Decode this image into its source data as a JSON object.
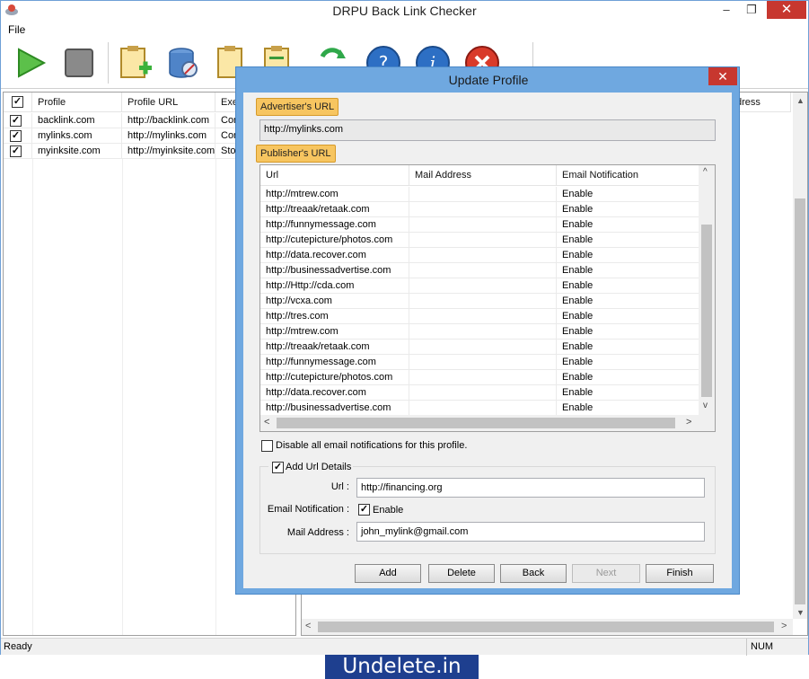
{
  "app": {
    "title": "DRPU Back Link Checker",
    "window_buttons": {
      "minimize": "–",
      "restore": "❐",
      "close": "✕"
    },
    "menu": [
      "File"
    ]
  },
  "toolbar": {
    "buttons": [
      {
        "name": "start",
        "icon": "play-icon"
      },
      {
        "name": "stop",
        "icon": "stop-icon"
      },
      {
        "name": "add-profile",
        "icon": "clipboard-add-icon"
      },
      {
        "name": "database",
        "icon": "database-icon"
      },
      {
        "name": "edit-profile",
        "icon": "clipboard-edit-icon"
      },
      {
        "name": "report",
        "icon": "clipboard-list-icon"
      },
      {
        "name": "refresh",
        "icon": "refresh-icon"
      },
      {
        "name": "help",
        "icon": "help-icon"
      },
      {
        "name": "about",
        "icon": "info-icon"
      },
      {
        "name": "exit",
        "icon": "exit-icon"
      }
    ]
  },
  "main_grid": {
    "headers": [
      "Profile",
      "Profile URL",
      "Exe"
    ],
    "rows": [
      {
        "checked": true,
        "profile": "backlink.com",
        "url": "http://backlink.com",
        "exe": "Cor"
      },
      {
        "checked": true,
        "profile": "mylinks.com",
        "url": "http://mylinks.com",
        "exe": "Cor"
      },
      {
        "checked": true,
        "profile": "myinksite.com",
        "url": "http://myinksite.com",
        "exe": "Sto"
      }
    ]
  },
  "right_grid": {
    "header_fragment": "dress"
  },
  "statusbar": {
    "left": "Ready",
    "right": "NUM"
  },
  "brand": "Undelete.in",
  "dialog": {
    "title": "Update Profile",
    "close": "✕",
    "advertiser_label": "Advertiser's URL",
    "advertiser_url": "http://mylinks.com",
    "publisher_label": "Publisher's URL",
    "publisher_headers": [
      "Url",
      "Mail Address",
      "Email Notification"
    ],
    "publisher_rows": [
      {
        "url": "http://mtrew.com",
        "mail": "",
        "notify": "Enable"
      },
      {
        "url": "http://treaak/retaak.com",
        "mail": "",
        "notify": "Enable"
      },
      {
        "url": "http://funnymessage.com",
        "mail": "",
        "notify": "Enable"
      },
      {
        "url": "http://cutepicture/photos.com",
        "mail": "",
        "notify": "Enable"
      },
      {
        "url": "http://data.recover.com",
        "mail": "",
        "notify": "Enable"
      },
      {
        "url": "http://businessadvertise.com",
        "mail": "",
        "notify": "Enable"
      },
      {
        "url": "http://Http://cda.com",
        "mail": "",
        "notify": "Enable"
      },
      {
        "url": "http://vcxa.com",
        "mail": "",
        "notify": "Enable"
      },
      {
        "url": "http://tres.com",
        "mail": "",
        "notify": "Enable"
      },
      {
        "url": "http://mtrew.com",
        "mail": "",
        "notify": "Enable"
      },
      {
        "url": "http://treaak/retaak.com",
        "mail": "",
        "notify": "Enable"
      },
      {
        "url": "http://funnymessage.com",
        "mail": "",
        "notify": "Enable"
      },
      {
        "url": "http://cutepicture/photos.com",
        "mail": "",
        "notify": "Enable"
      },
      {
        "url": "http://data.recover.com",
        "mail": "",
        "notify": "Enable"
      },
      {
        "url": "http://businessadvertise.com",
        "mail": "",
        "notify": "Enable"
      }
    ],
    "disable_all_label": "Disable all email notifications for this profile.",
    "disable_all_checked": false,
    "add_details_label": "Add Url Details",
    "add_details_checked": true,
    "url_label": "Url :",
    "url_value": "http://financing.org",
    "email_notification_label": "Email Notification :",
    "enable_label": "Enable",
    "enable_checked": true,
    "mail_label": "Mail Address :",
    "mail_value": "john_mylink@gmail.com",
    "buttons": {
      "add": "Add",
      "delete": "Delete",
      "back": "Back",
      "next": "Next",
      "finish": "Finish"
    }
  },
  "colors": {
    "dialog_frame": "#6fa8e0",
    "tag": "#f7c560",
    "brand": "#1e3f8f",
    "close": "#c7372f"
  }
}
